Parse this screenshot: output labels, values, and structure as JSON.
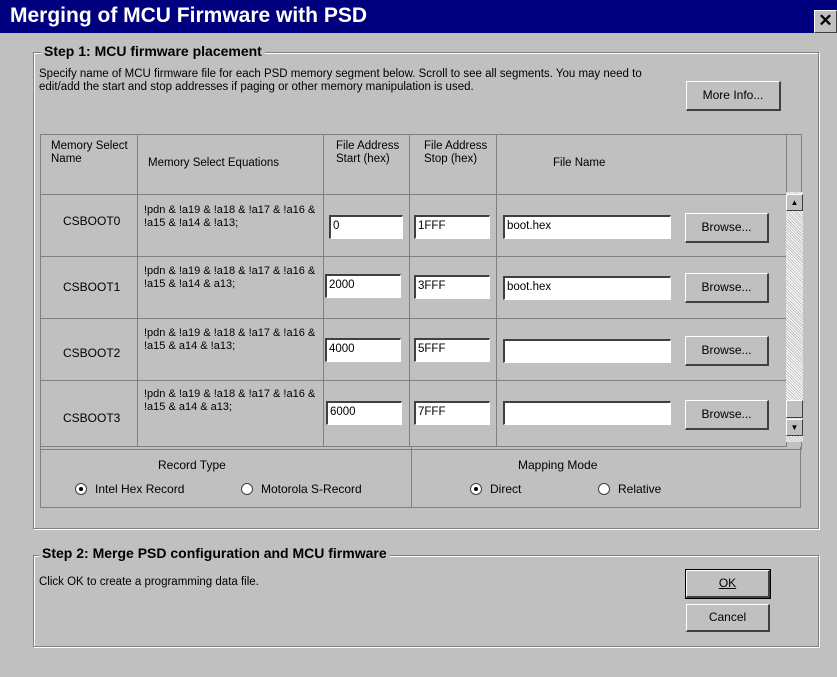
{
  "window": {
    "title": "Merging of MCU Firmware with PSD",
    "close_label": "✕"
  },
  "step1": {
    "legend": "Step 1: MCU firmware placement",
    "description": "Specify name of MCU firmware file for each PSD memory segment below. Scroll to see all segments. You may need to edit/add the start and stop addresses if paging or other memory manipulation is used.",
    "more_info": "More Info..."
  },
  "table": {
    "headers": {
      "select_name": "Memory Select Name",
      "equations": "Memory Select Equations",
      "start": "File Address Start (hex)",
      "stop": "File Address Stop (hex)",
      "file": "File Name"
    },
    "rows": [
      {
        "name": "CSBOOT0",
        "equation": "!pdn & !a19 & !a18 & !a17 & !a16 & !a15 & !a14 & !a13;",
        "start": "0",
        "stop": "1FFF",
        "file": "boot.hex",
        "browse": "Browse..."
      },
      {
        "name": "CSBOOT1",
        "equation": "!pdn & !a19 & !a18 & !a17 & !a16 & !a15 & !a14 & a13;",
        "start": "2000",
        "stop": "3FFF",
        "file": "boot.hex",
        "browse": "Browse..."
      },
      {
        "name": "CSBOOT2",
        "equation": "!pdn & !a19 & !a18 & !a17 & !a16 & !a15 & a14 & !a13;",
        "start": "4000",
        "stop": "5FFF",
        "file": "",
        "browse": "Browse..."
      },
      {
        "name": "CSBOOT3",
        "equation": "!pdn & !a19 & !a18 & !a17 & !a16 & !a15 & a14 & a13;",
        "start": "6000",
        "stop": "7FFF",
        "file": "",
        "browse": "Browse..."
      }
    ]
  },
  "record_type": {
    "label": "Record Type",
    "options": [
      {
        "label": "Intel Hex Record",
        "selected": true
      },
      {
        "label": "Motorola S-Record",
        "selected": false
      }
    ]
  },
  "mapping_mode": {
    "label": "Mapping Mode",
    "options": [
      {
        "label": "Direct",
        "selected": true
      },
      {
        "label": "Relative",
        "selected": false
      }
    ]
  },
  "step2": {
    "legend": "Step 2: Merge PSD configuration and MCU firmware",
    "description": "Click OK to create a programming data file.",
    "ok": "OK",
    "cancel": "Cancel"
  },
  "icons": {
    "scroll_up": "scroll-up-arrow-icon",
    "scroll_down": "scroll-down-arrow-icon"
  },
  "colors": {
    "titlebar": "#00007f",
    "face": "#c0c0c0"
  }
}
